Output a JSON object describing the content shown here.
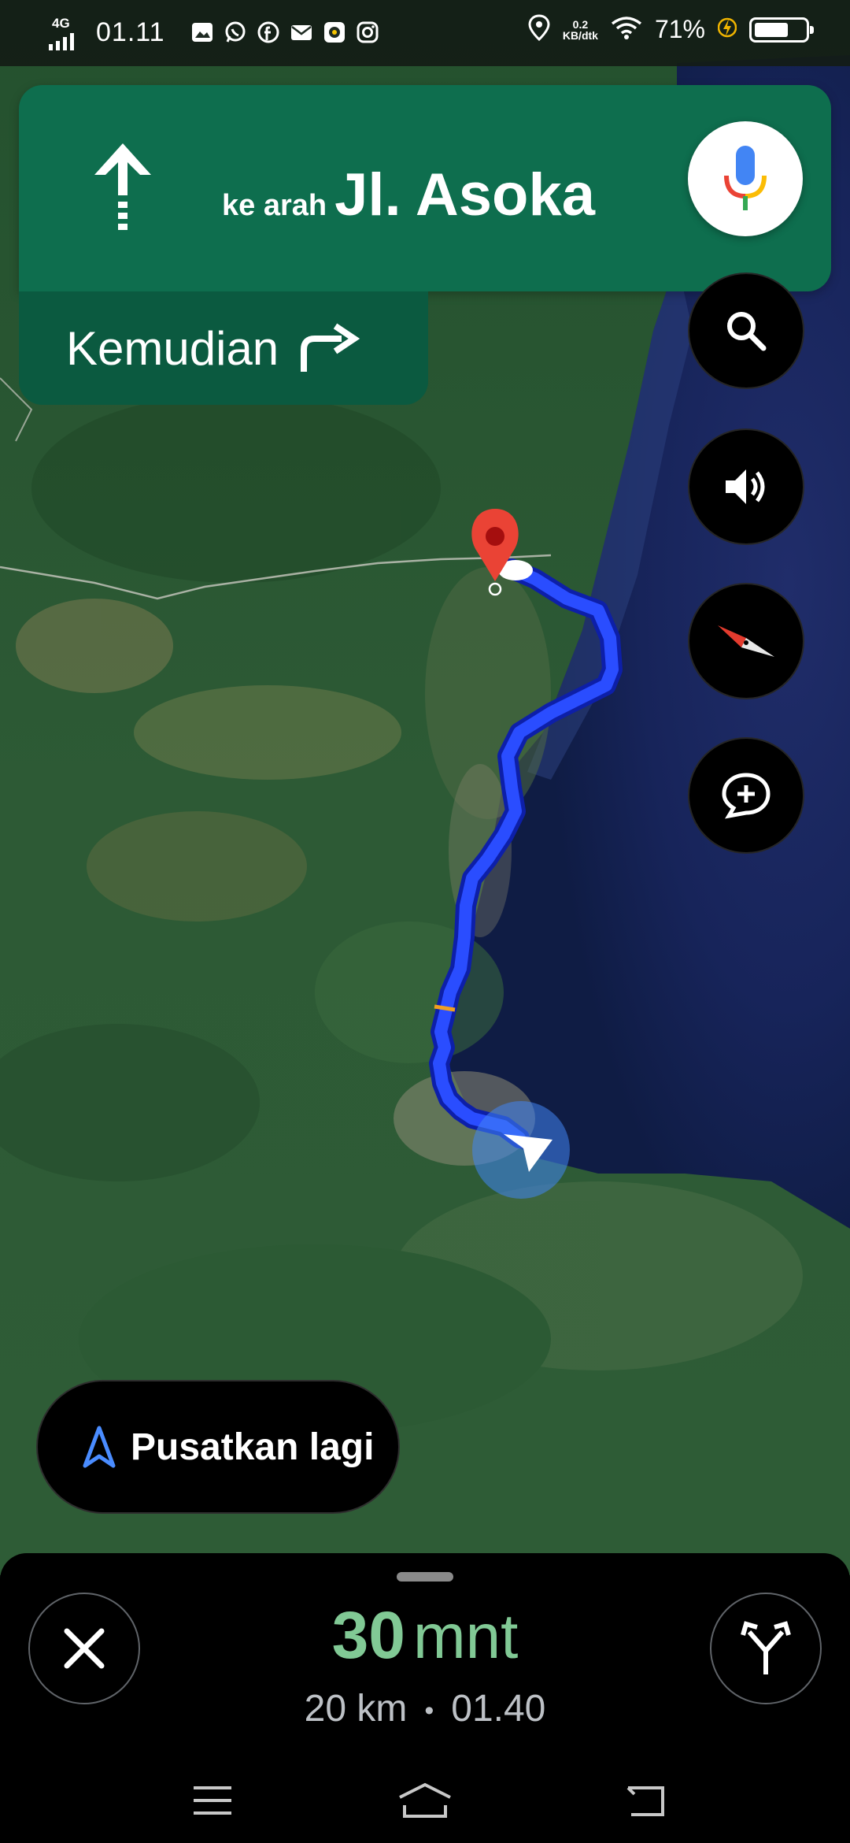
{
  "status_bar": {
    "network": "4G",
    "time": "01.11",
    "data_speed_value": "0.2",
    "data_speed_unit": "KB/dtk",
    "battery_percent": "71%",
    "battery_level": 0.71,
    "icons": [
      "signal-icon",
      "gallery-icon",
      "whatsapp-icon",
      "facebook-icon",
      "email-icon",
      "app-icon",
      "instagram-icon",
      "location-icon",
      "wifi-icon",
      "charging-icon",
      "battery-icon"
    ]
  },
  "direction": {
    "prefix": "ke arah",
    "street": "Jl. Asoka",
    "maneuver_icon": "straight-arrow-icon",
    "then_label": "Kemudian",
    "then_icon": "turn-right-icon"
  },
  "map_controls": [
    "mic-icon",
    "search-icon",
    "volume-icon",
    "compass-icon",
    "add-report-icon"
  ],
  "recenter": {
    "label": "Pusatkan lagi",
    "icon": "navigation-arrow-icon"
  },
  "trip": {
    "eta_value": "30",
    "eta_unit": "mnt",
    "distance": "20 km",
    "separator": "•",
    "arrival_time": "01.40"
  },
  "colors": {
    "banner": "#0e6e4e",
    "banner_secondary": "#0b5a40",
    "route": "#2a4dff",
    "eta_text": "#81c995",
    "panel": "#000000"
  }
}
